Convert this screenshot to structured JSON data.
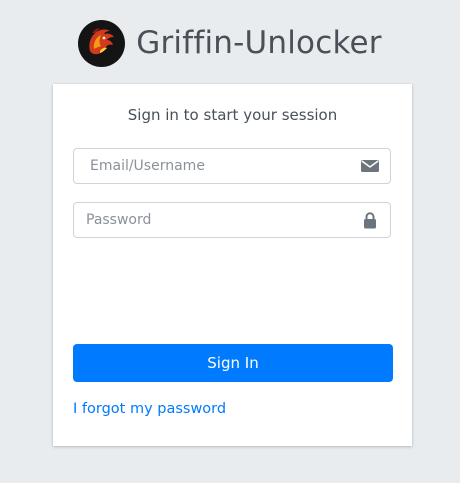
{
  "brand": {
    "title": "Griffin-Unlocker",
    "logo_icon": "dragon-logo-icon"
  },
  "login": {
    "message": "Sign in to start your session",
    "email": {
      "placeholder": "Email/Username",
      "value": "",
      "icon": "envelope-icon"
    },
    "password": {
      "placeholder": "Password",
      "value": "",
      "icon": "lock-icon"
    },
    "signin_label": "Sign In",
    "forgot_label": "I forgot my password"
  },
  "colors": {
    "background": "#e9ecef",
    "primary": "#007bff",
    "card": "#ffffff",
    "text": "#495057"
  }
}
